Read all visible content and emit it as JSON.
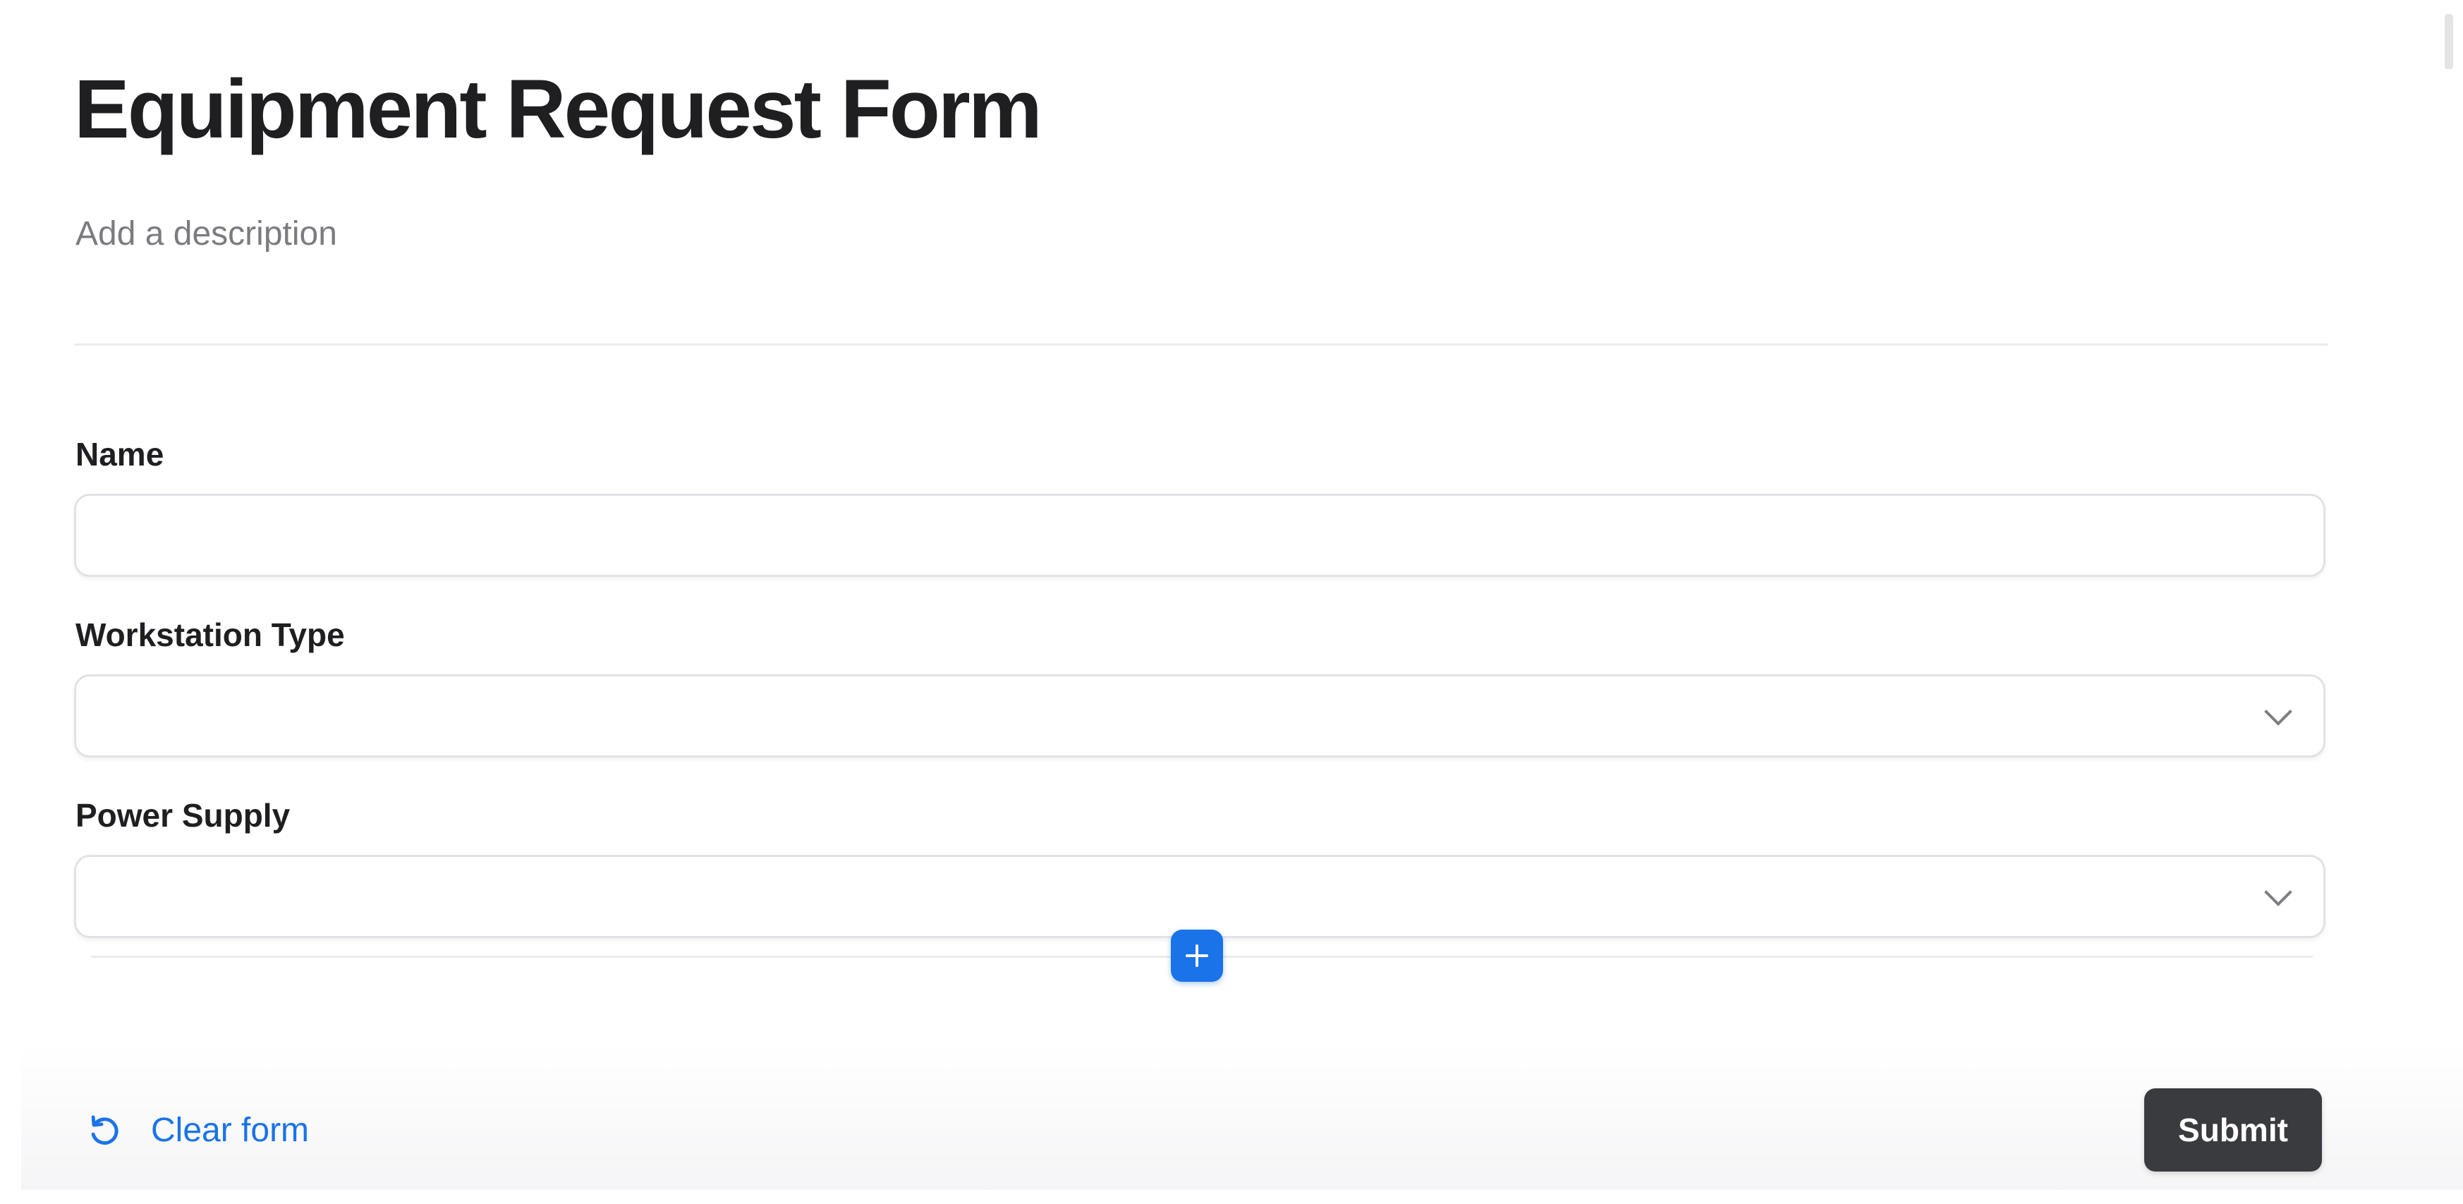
{
  "form": {
    "title": "Equipment Request Form",
    "description_placeholder": "Add a description"
  },
  "fields": [
    {
      "label": "Name",
      "type": "text",
      "value": ""
    },
    {
      "label": "Workstation Type",
      "type": "dropdown",
      "value": ""
    },
    {
      "label": "Power Supply",
      "type": "dropdown",
      "value": ""
    }
  ],
  "actions": {
    "add_field_icon": "plus-icon",
    "clear_label": "Clear form",
    "clear_icon": "undo-icon",
    "submit_label": "Submit"
  },
  "colors": {
    "accent": "#1a73e8",
    "submit_background": "#3a3b3f",
    "label_text": "#1f1f22",
    "placeholder_text": "#7b7b80"
  }
}
